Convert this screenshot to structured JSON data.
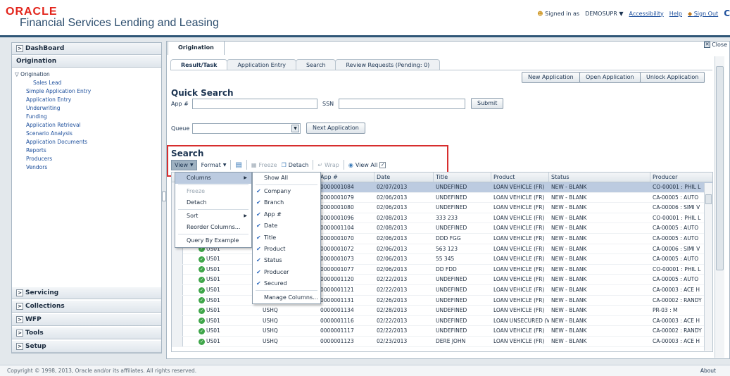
{
  "header": {
    "logo_brand": "ORACLE",
    "logo_product": "Financial Services Lending and Leasing",
    "signed_in_label": "Signed in as",
    "user": "DEMOSUPR",
    "user_caret": "▼",
    "links": [
      "Accessibility",
      "Help",
      "Sign Out"
    ],
    "signout_icon": "C"
  },
  "nav": {
    "dashboard": "DashBoard",
    "origination_header": "Origination",
    "origination_group": "Origination",
    "items": [
      "Sales Lead",
      "Simple Application Entry",
      "Application Entry",
      "Underwriting",
      "Funding",
      "Application Retrieval",
      "Scenario Analysis",
      "Application Documents",
      "Reports",
      "Producers",
      "Vendors"
    ],
    "bottom": [
      "Servicing",
      "Collections",
      "WFP",
      "Tools",
      "Setup"
    ]
  },
  "content": {
    "main_tab": "Origination",
    "close_label": "Close",
    "subtabs": [
      "Result/Task",
      "Application Entry",
      "Search",
      "Review Requests (Pending: 0)"
    ],
    "action_buttons": [
      "New Application",
      "Open Application",
      "Unlock Application"
    ],
    "quick_search": {
      "title": "Quick Search",
      "app_label": "App #",
      "ssn_label": "SSN",
      "submit": "Submit",
      "queue_label": "Queue",
      "next_button": "Next Application"
    },
    "search": {
      "title": "Search",
      "toolbar": {
        "view": "View",
        "format": "Format",
        "freeze": "Freeze",
        "detach": "Detach",
        "wrap": "Wrap",
        "view_all": "View All"
      }
    }
  },
  "table": {
    "columns": [
      "",
      "",
      "App #",
      "Date",
      "Title",
      "Product",
      "Status",
      "Producer"
    ],
    "rows": [
      [
        "",
        "",
        "0000001084",
        "02/07/2013",
        "UNDEFINED",
        "LOAN VEHICLE (FR)",
        "NEW - BLANK",
        "CO-00001 : PHIL L"
      ],
      [
        "",
        "",
        "0000001079",
        "02/06/2013",
        "UNDEFINED",
        "LOAN VEHICLE (FR)",
        "NEW - BLANK",
        "CA-00005 : AUTO"
      ],
      [
        "",
        "",
        "0000001080",
        "02/06/2013",
        "UNDEFINED",
        "LOAN VEHICLE (FR)",
        "NEW - BLANK",
        "CA-00006 : SIMI V"
      ],
      [
        "",
        "",
        "0000001096",
        "02/08/2013",
        "333 233",
        "LOAN VEHICLE (FR)",
        "NEW - BLANK",
        "CO-00001 : PHIL L"
      ],
      [
        "",
        "",
        "0000001104",
        "02/08/2013",
        "UNDEFINED",
        "LOAN VEHICLE (FR)",
        "NEW - BLANK",
        "CA-00005 : AUTO"
      ],
      [
        "",
        "",
        "0000001070",
        "02/06/2013",
        "DDD FGG",
        "LOAN VEHICLE (FR)",
        "NEW - BLANK",
        "CA-00005 : AUTO"
      ],
      [
        "US01",
        "",
        "0000001072",
        "02/06/2013",
        "563 123",
        "LOAN VEHICLE (FR)",
        "NEW - BLANK",
        "CA-00006 : SIMI V"
      ],
      [
        "US01",
        "",
        "0000001073",
        "02/06/2013",
        "55 345",
        "LOAN VEHICLE (FR)",
        "NEW - BLANK",
        "CA-00005 : AUTO"
      ],
      [
        "US01",
        "",
        "0000001077",
        "02/06/2013",
        "DD FDD",
        "LOAN VEHICLE (FR)",
        "NEW - BLANK",
        "CO-00001 : PHIL L"
      ],
      [
        "US01",
        "",
        "0000001120",
        "02/22/2013",
        "UNDEFINED",
        "LOAN VEHICLE (FR)",
        "NEW - BLANK",
        "CA-00005 : AUTO"
      ],
      [
        "US01",
        "",
        "0000001121",
        "02/22/2013",
        "UNDEFINED",
        "LOAN VEHICLE (FR)",
        "NEW - BLANK",
        "CA-00003 : ACE H"
      ],
      [
        "US01",
        "",
        "0000001131",
        "02/26/2013",
        "UNDEFINED",
        "LOAN VEHICLE (FR)",
        "NEW - BLANK",
        "CA-00002 : RANDY"
      ],
      [
        "US01",
        "USHQ",
        "0000001134",
        "02/28/2013",
        "UNDEFINED",
        "LOAN VEHICLE (FR)",
        "NEW - BLANK",
        "PR-03 : M"
      ],
      [
        "US01",
        "USHQ",
        "0000001116",
        "02/22/2013",
        "UNDEFINED",
        "LOAN UNSECURED (V",
        "NEW - BLANK",
        "CA-00003 : ACE H"
      ],
      [
        "US01",
        "USHQ",
        "0000001117",
        "02/22/2013",
        "UNDEFINED",
        "LOAN VEHICLE (FR)",
        "NEW - BLANK",
        "CA-00002 : RANDY"
      ],
      [
        "US01",
        "USHQ",
        "0000001123",
        "02/23/2013",
        "DERE JOHN",
        "LOAN VEHICLE (FR)",
        "NEW - BLANK",
        "CA-00003 : ACE H"
      ]
    ]
  },
  "view_menu": {
    "items": [
      "Columns",
      "Freeze",
      "Detach",
      "Sort",
      "Reorder Columns...",
      "Query By Example"
    ]
  },
  "columns_menu": {
    "show_all": "Show All",
    "items": [
      "Company",
      "Branch",
      "App #",
      "Date",
      "Title",
      "Product",
      "Status",
      "Producer",
      "Secured"
    ],
    "manage": "Manage Columns..."
  },
  "footer": {
    "copyright": "Copyright © 1998, 2013, Oracle and/or its affiliates. All rights reserved.",
    "about": "About"
  },
  "colors": {
    "accent": "#d72e2e",
    "brand": "#e2231a",
    "selection": "#bccbe0"
  }
}
